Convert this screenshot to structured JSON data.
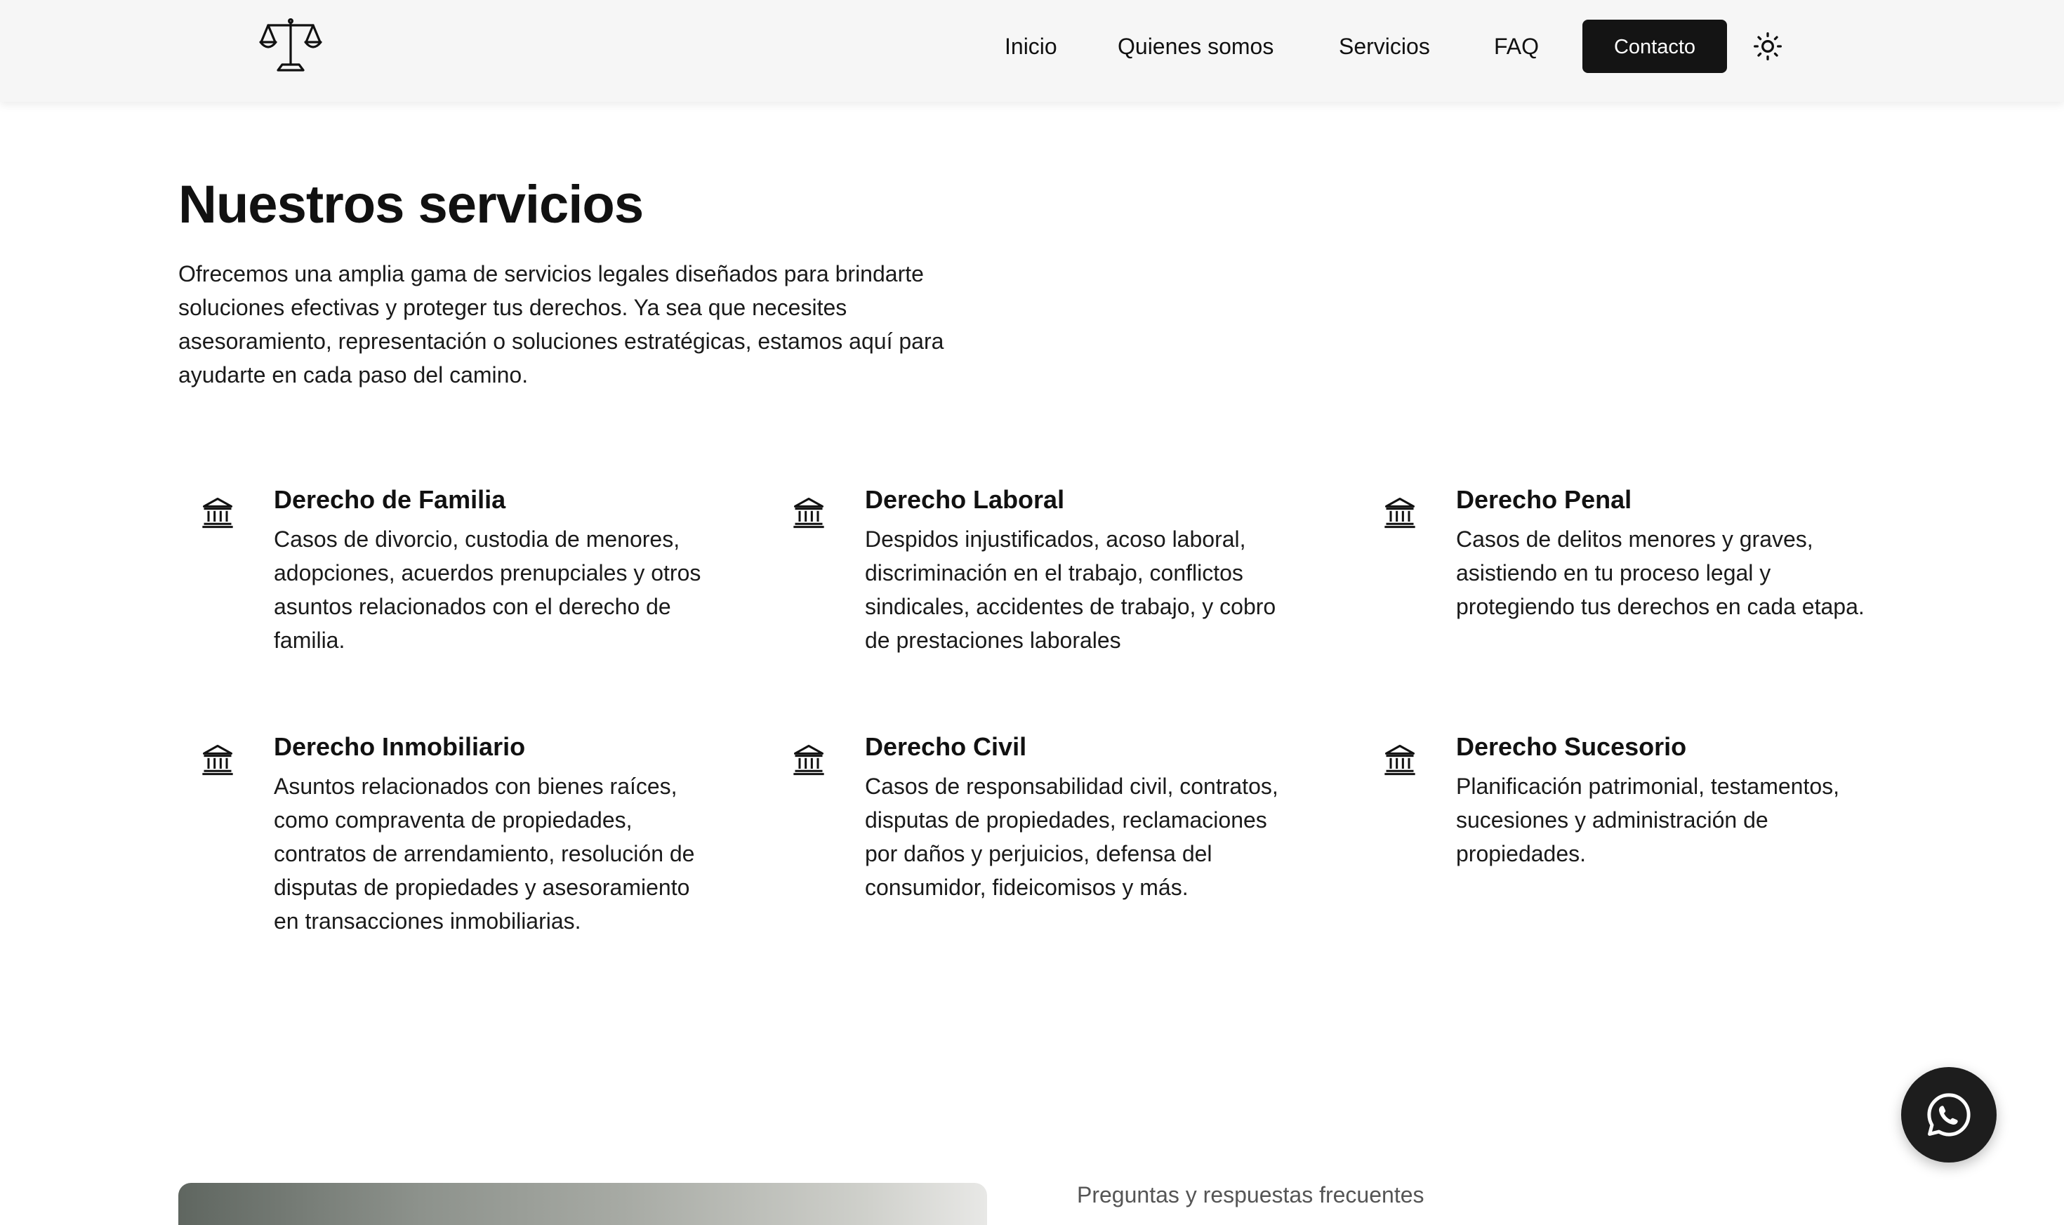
{
  "header": {
    "logo_icon": "scales-of-justice-icon",
    "nav": {
      "inicio": "Inicio",
      "quienes": "Quienes somos",
      "servicios": "Servicios",
      "faq": "FAQ"
    },
    "contact_label": "Contacto",
    "theme_icon": "sun-icon"
  },
  "services": {
    "title": "Nuestros servicios",
    "intro": "Ofrecemos una amplia gama de servicios legales diseñados para brindarte soluciones efectivas y proteger tus derechos. Ya sea que necesites asesoramiento, representación o soluciones estratégicas, estamos aquí para ayudarte en cada paso del camino.",
    "icon": "courthouse-icon",
    "items": [
      {
        "title": "Derecho de Familia",
        "description": "Casos de divorcio, custodia de menores, adopciones, acuerdos prenupciales y otros asuntos relacionados con el derecho de familia."
      },
      {
        "title": "Derecho Laboral",
        "description": "Despidos injustificados, acoso laboral, discriminación en el trabajo, conflictos sindicales, accidentes de trabajo, y cobro de prestaciones laborales"
      },
      {
        "title": "Derecho Penal",
        "description": "Casos de delitos menores y graves, asistiendo en tu proceso legal y protegiendo tus derechos en cada etapa."
      },
      {
        "title": "Derecho Inmobiliario",
        "description": "Asuntos relacionados con bienes raíces, como compraventa de propiedades, contratos de arrendamiento, resolución de disputas de propiedades y asesoramiento en transacciones inmobiliarias."
      },
      {
        "title": "Derecho Civil",
        "description": "Casos de responsabilidad civil, contratos, disputas de propiedades, reclamaciones por daños y perjuicios, defensa del consumidor, fideicomisos y más."
      },
      {
        "title": "Derecho Sucesorio",
        "description": "Planificación patrimonial, testamentos, sucesiones y administración de propiedades."
      }
    ]
  },
  "faq": {
    "label": "Preguntas y respuestas frecuentes"
  },
  "whatsapp": {
    "icon": "whatsapp-icon"
  },
  "colors": {
    "header_bg": "#f6f6f6",
    "button_bg": "#141414",
    "text": "#111111",
    "whatsapp_bg": "#1d1d1d"
  }
}
